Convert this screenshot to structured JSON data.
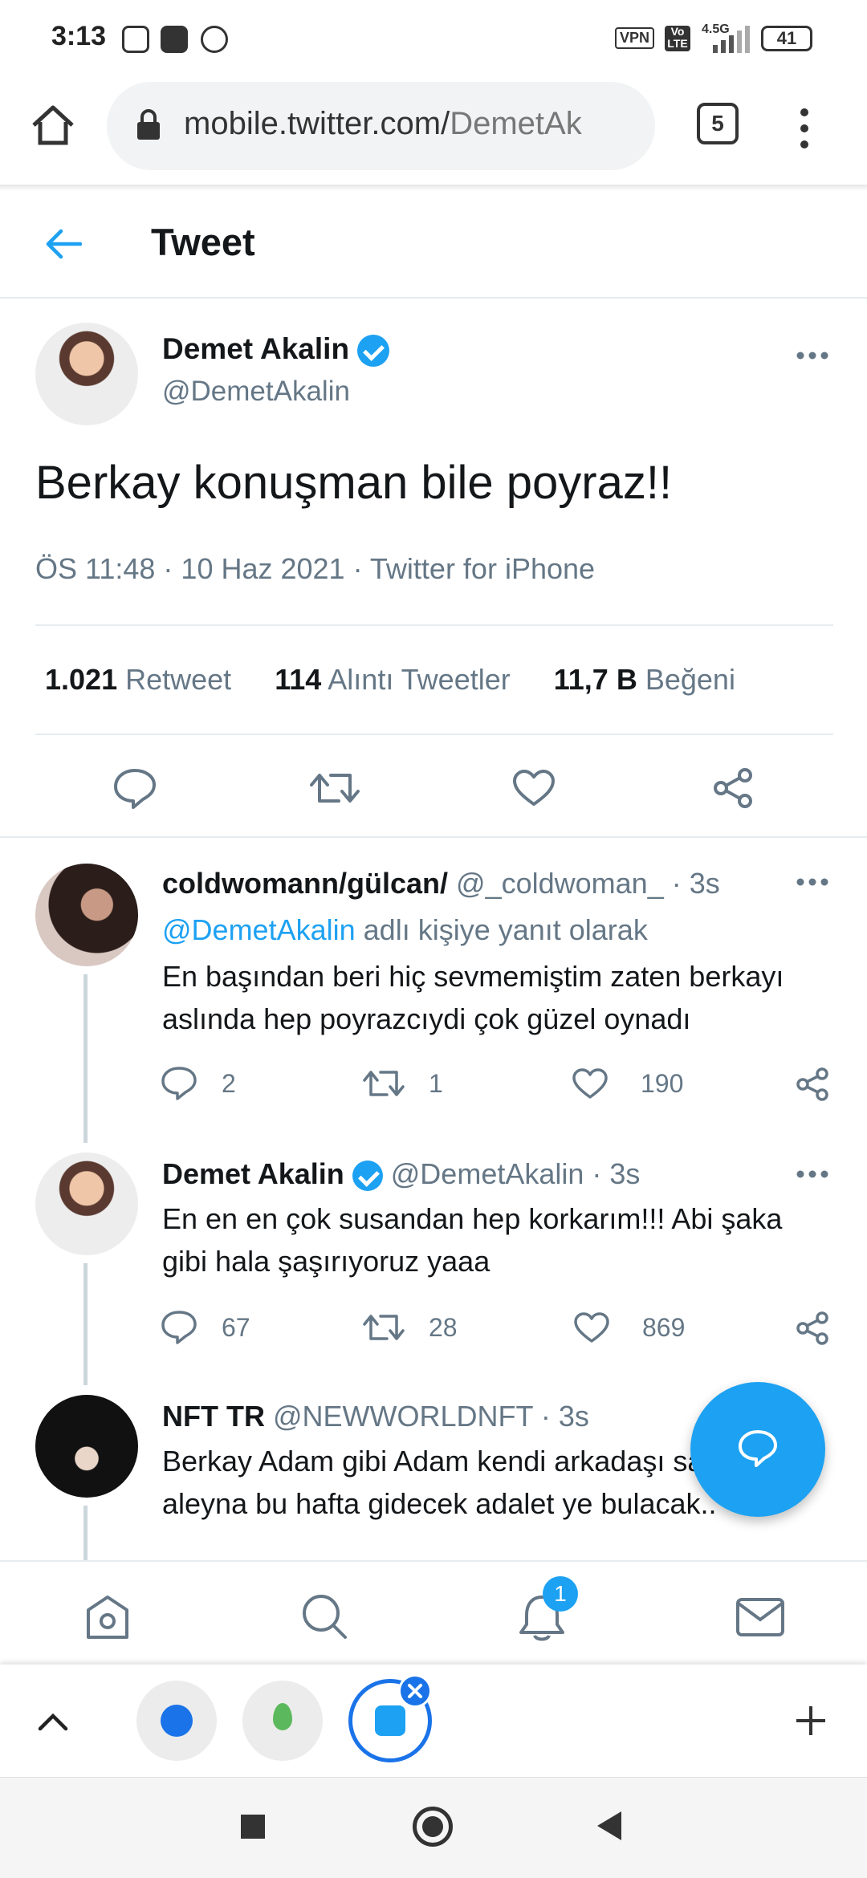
{
  "status_bar": {
    "time": "3:13",
    "vpn": "VPN",
    "volte": "Vo LTE",
    "network": "4.5G",
    "battery": "41"
  },
  "browser": {
    "url_host": "mobile.twitter.com/",
    "url_path": "DemetAk",
    "tab_count": "5"
  },
  "header": {
    "title": "Tweet"
  },
  "main_tweet": {
    "name": "Demet Akalin",
    "handle": "@DemetAkalin",
    "text": "Berkay konuşman bile poyraz!!",
    "meta": "ÖS 11:48 · 10 Haz 2021 · Twitter for iPhone",
    "retweets_count": "1.021",
    "retweets_label": "Retweet",
    "quotes_count": "114",
    "quotes_label": "Alıntı Tweetler",
    "likes_count": "11,7 B",
    "likes_label": "Beğeni"
  },
  "replies": [
    {
      "name": "coldwomann/gülcan/",
      "handle": "@_coldwoman_",
      "time": "· 3s",
      "reply_to_handle": "@DemetAkalin",
      "reply_to_suffix": "adlı kişiye yanıt olarak",
      "text": "En başından beri hiç sevmemiştim zaten berkayı aslında hep poyrazcıydi çok güzel oynadı",
      "replies": "2",
      "retweets": "1",
      "likes": "190"
    },
    {
      "name": "Demet Akalin",
      "handle": "@DemetAkalin",
      "time": "· 3s",
      "text": "En en en çok susandan hep korkarım!!! Abi şaka gibi hala şaşırıyoruz yaaa",
      "replies": "67",
      "retweets": "28",
      "likes": "869"
    },
    {
      "name": "NFT TR",
      "handle": "@NEWWORLDNFT",
      "time": "· 3s",
      "text": "Berkay Adam gibi Adam kendi arkadaşı satmadı aleyna bu hafta gidecek adalet ye bulacak.."
    }
  ],
  "bottom_nav": {
    "notification_count": "1"
  },
  "colors": {
    "accent": "#1da1f2",
    "text": "#14171a",
    "muted": "#657786",
    "divider": "#e6ecf0"
  }
}
